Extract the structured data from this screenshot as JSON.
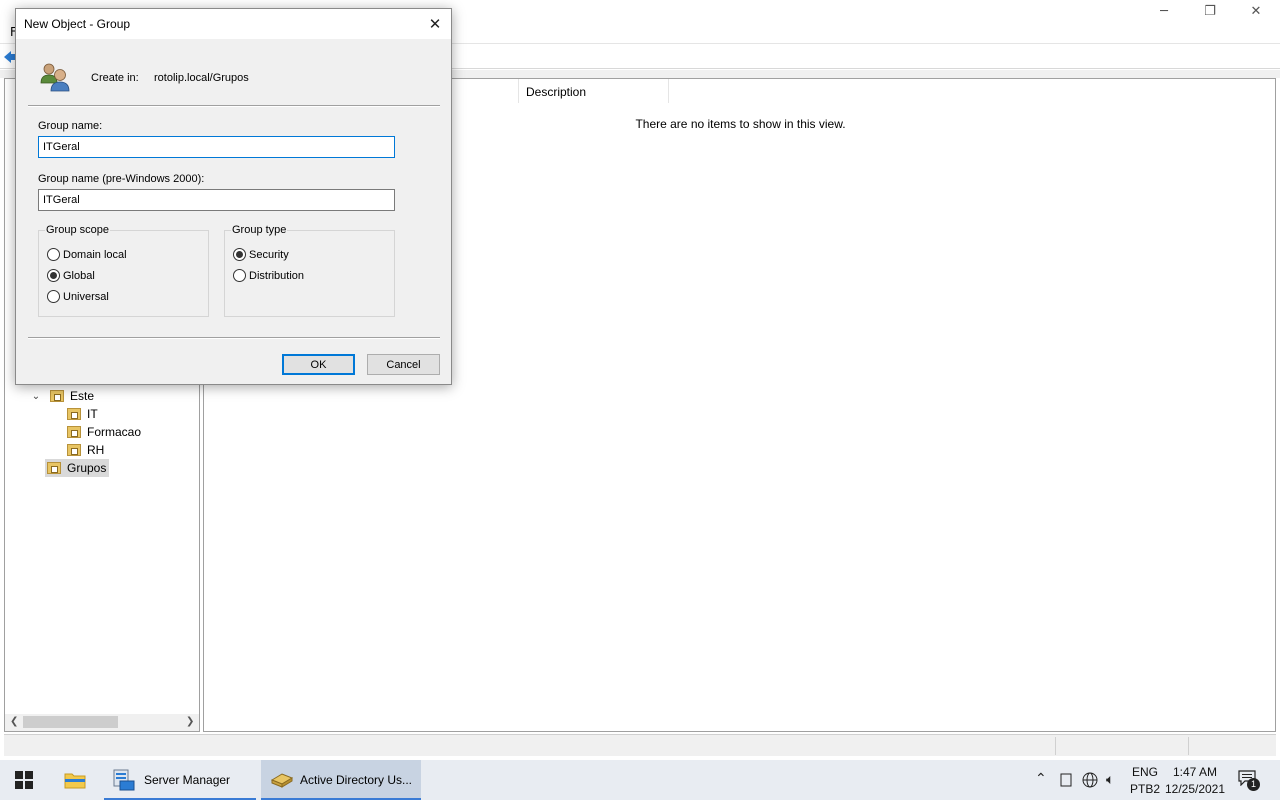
{
  "mmc": {
    "menu_file": "F",
    "tree": [
      {
        "label": "Este",
        "icon": "folder-icon",
        "expanded": true
      },
      {
        "label": "IT",
        "icon": "folder-icon"
      },
      {
        "label": "Formacao",
        "icon": "folder-icon"
      },
      {
        "label": "RH",
        "icon": "folder-icon"
      },
      {
        "label": "Grupos",
        "icon": "folder-icon",
        "selected": true
      }
    ],
    "list": {
      "column_description": "Description",
      "empty_message": "There are no items to show in this view."
    }
  },
  "dialog": {
    "title": "New Object - Group",
    "create_in_label": "Create in:",
    "create_in_value": "rotolip.local/Grupos",
    "group_name_label": "Group name:",
    "group_name_value": "ITGeral",
    "pre2000_label": "Group name (pre-Windows 2000):",
    "pre2000_value": "ITGeral",
    "scope": {
      "legend": "Group scope",
      "options": [
        "Domain local",
        "Global",
        "Universal"
      ],
      "selected": "Global"
    },
    "type": {
      "legend": "Group type",
      "options": [
        "Security",
        "Distribution"
      ],
      "selected": "Security"
    },
    "ok_label": "OK",
    "cancel_label": "Cancel"
  },
  "taskbar": {
    "apps": [
      {
        "label": "Server Manager",
        "icon": "server-manager-icon"
      },
      {
        "label": "Active Directory Us...",
        "icon": "active-directory-icon",
        "active": true
      }
    ],
    "language": "ENG",
    "layout": "PTB2",
    "time": "1:47 AM",
    "date": "12/25/2021",
    "notification_count": "1"
  },
  "colors": {
    "accent": "#0078d7",
    "taskbar": "#e8ecf2",
    "folder": "#e8c564"
  }
}
